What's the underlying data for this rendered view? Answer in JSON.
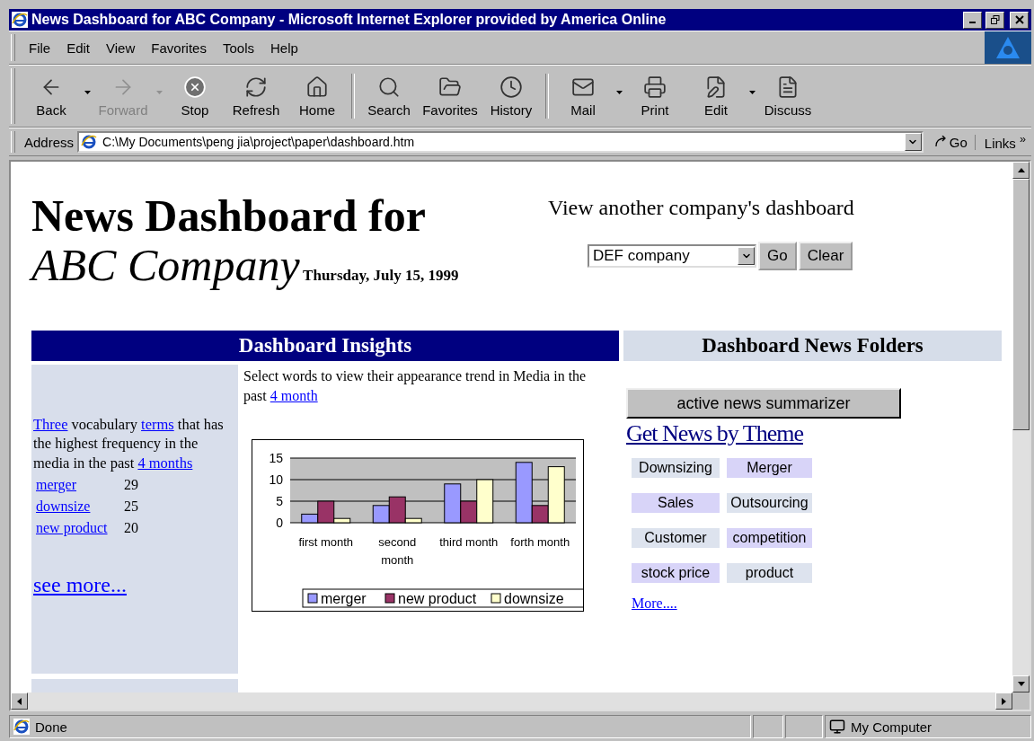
{
  "window": {
    "title": "News Dashboard for ABC Company - Microsoft Internet Explorer provided by America Online"
  },
  "menu": [
    "File",
    "Edit",
    "View",
    "Favorites",
    "Tools",
    "Help"
  ],
  "toolbar": [
    {
      "label": "Back",
      "kind": "back",
      "disabled": false,
      "dropdown": true,
      "group_end": false
    },
    {
      "label": "Forward",
      "kind": "forward",
      "disabled": true,
      "dropdown": true,
      "group_end": false
    },
    {
      "label": "Stop",
      "kind": "stop",
      "disabled": false,
      "dropdown": false,
      "group_end": false
    },
    {
      "label": "Refresh",
      "kind": "refresh",
      "disabled": false,
      "dropdown": false,
      "group_end": false
    },
    {
      "label": "Home",
      "kind": "home",
      "disabled": false,
      "dropdown": false,
      "group_end": true
    },
    {
      "label": "Search",
      "kind": "search",
      "disabled": false,
      "dropdown": false,
      "group_end": false
    },
    {
      "label": "Favorites",
      "kind": "favorites",
      "disabled": false,
      "dropdown": false,
      "group_end": false
    },
    {
      "label": "History",
      "kind": "history",
      "disabled": false,
      "dropdown": false,
      "group_end": true
    },
    {
      "label": "Mail",
      "kind": "mail",
      "disabled": false,
      "dropdown": true,
      "group_end": false
    },
    {
      "label": "Print",
      "kind": "print",
      "disabled": false,
      "dropdown": false,
      "group_end": false
    },
    {
      "label": "Edit",
      "kind": "edit",
      "disabled": false,
      "dropdown": true,
      "group_end": false
    },
    {
      "label": "Discuss",
      "kind": "discuss",
      "disabled": false,
      "dropdown": false,
      "group_end": false
    }
  ],
  "address": {
    "label": "Address",
    "value": "C:\\My Documents\\peng jia\\project\\paper\\dashboard.htm",
    "go": "Go",
    "links": "Links",
    "links_chevron": "»"
  },
  "page": {
    "title_line1": "News Dashboard for",
    "title_line2": "ABC Company",
    "date": "Thursday, July 15, 1999",
    "other": {
      "heading": "View another company's dashboard",
      "select_value": "DEF company",
      "go": "Go",
      "clear": "Clear"
    },
    "insights_header": "Dashboard Insights",
    "folders_header": "Dashboard News Folders",
    "vocab_sentence": [
      {
        "kind": "link",
        "text": "Three"
      },
      {
        "kind": "text",
        "text": " vocabulary "
      },
      {
        "kind": "link",
        "text": "terms"
      },
      {
        "kind": "text",
        "text": "  that has the highest frequency in the media in the past "
      },
      {
        "kind": "link",
        "text": "4 months"
      }
    ],
    "terms": [
      {
        "term": "merger",
        "count": "29"
      },
      {
        "term": "downsize",
        "count": "25"
      },
      {
        "term": "new product",
        "count": "20"
      }
    ],
    "see_more": "see more...",
    "trend_text": "Select words to view their appearance trend in Media in the past ",
    "trend_link": "4 month",
    "chart_data": {
      "type": "bar",
      "categories": [
        "first month",
        "second month",
        "third month",
        "forth month"
      ],
      "series": [
        {
          "name": "merger",
          "color": "#9999ff",
          "values": [
            2,
            4,
            9,
            14
          ]
        },
        {
          "name": "new product",
          "color": "#993366",
          "values": [
            5,
            6,
            5,
            4
          ]
        },
        {
          "name": "downsize",
          "color": "#ffffcc",
          "values": [
            1,
            1,
            10,
            13
          ]
        }
      ],
      "ylim": [
        0,
        15
      ],
      "yticks": [
        0,
        5,
        10,
        15
      ],
      "legend": "bottom"
    },
    "summarizer": "active news summarizer",
    "theme_heading": "Get News by Theme",
    "themes": [
      {
        "label": "Downsizing",
        "color": "#dde3ee"
      },
      {
        "label": "Merger",
        "color": "#d8d4f8"
      },
      {
        "label": "Sales",
        "color": "#d8d4f8"
      },
      {
        "label": "Outsourcing",
        "color": "#dde3ee"
      },
      {
        "label": "Customer",
        "color": "#dde3ee"
      },
      {
        "label": "competition",
        "color": "#d8d4f8"
      },
      {
        "label": "stock price",
        "color": "#d8d4f8"
      },
      {
        "label": "product",
        "color": "#dde3ee"
      }
    ],
    "more": "More...."
  },
  "status": {
    "text": "Done",
    "zone": "My Computer"
  }
}
